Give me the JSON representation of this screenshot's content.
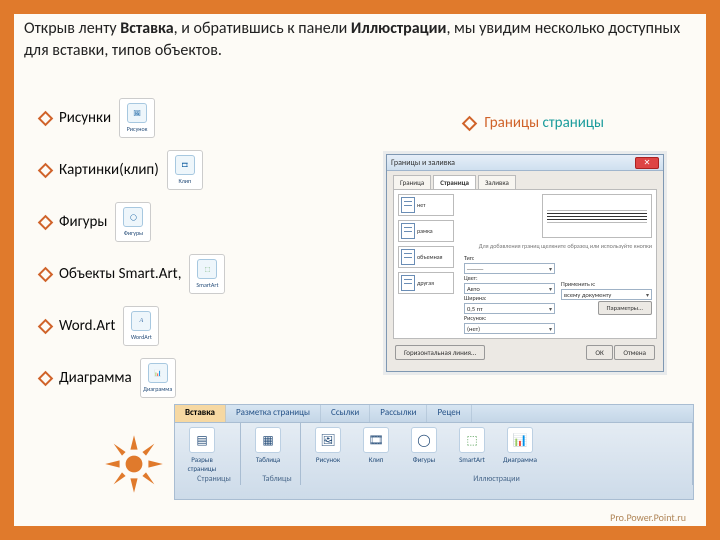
{
  "title": {
    "pre": "Открыв ленту ",
    "insert": "Вставка",
    "mid": ", и обратившись к панели ",
    "illus": "Иллюстрации",
    "post": ", мы увидим несколько доступных для вставки, типов объектов."
  },
  "bullets": [
    {
      "label": "Рисунки",
      "icon_caption": "Рисунок"
    },
    {
      "label": "Картинки(клип)",
      "icon_caption": "Клип"
    },
    {
      "label": "Фигуры",
      "icon_caption": "Фигуры"
    },
    {
      "label": " Объекты Smart.Art,",
      "icon_caption": "SmartArt"
    },
    {
      "label": "Word.Art",
      "icon_caption": "WordArt"
    },
    {
      "label": "Диаграмма",
      "icon_caption": "Диаграмма"
    }
  ],
  "right_heading": {
    "text1": "Границы",
    "text2": "страницы"
  },
  "dialog": {
    "title": "Границы и заливка",
    "close": "✕",
    "tabs": [
      "Граница",
      "Страница",
      "Заливка"
    ],
    "active_tab": 1,
    "thumbs": [
      "нет",
      "рамка",
      "объемная",
      "другая"
    ],
    "preview_hint": "Для добавления границ щелкните образец или используйте кнопки",
    "fields": {
      "type_label": "Тип:",
      "color_label": "Цвет:",
      "color_value": "Авто",
      "width_label": "Ширина:",
      "width_value": "0,5 пт",
      "art_label": "Рисунок:",
      "art_value": "(нет)",
      "apply_label": "Применить к:",
      "apply_value": "всему документу"
    },
    "buttons": {
      "options": "Параметры...",
      "hline": "Горизонтальная линия...",
      "ok": "ОК",
      "cancel": "Отмена"
    }
  },
  "ribbon": {
    "tabs": [
      "Вставка",
      "Разметка страницы",
      "Ссылки",
      "Рассылки",
      "Рецен"
    ],
    "groups": [
      {
        "label": "Страницы",
        "items": [
          {
            "label": "Разрыв страницы",
            "glyph": "▤"
          }
        ]
      },
      {
        "label": "Таблицы",
        "items": [
          {
            "label": "Таблица",
            "glyph": "▦"
          }
        ]
      },
      {
        "label": "Иллюстрации",
        "items": [
          {
            "label": "Рисунок",
            "glyph": "🖼"
          },
          {
            "label": "Клип",
            "glyph": "🎞"
          },
          {
            "label": "Фигуры",
            "glyph": "◯"
          },
          {
            "label": "SmartArt",
            "glyph": "⬚"
          },
          {
            "label": "Диаграмма",
            "glyph": "📊"
          }
        ]
      }
    ]
  },
  "footer": "Pro.Power.Point.ru"
}
